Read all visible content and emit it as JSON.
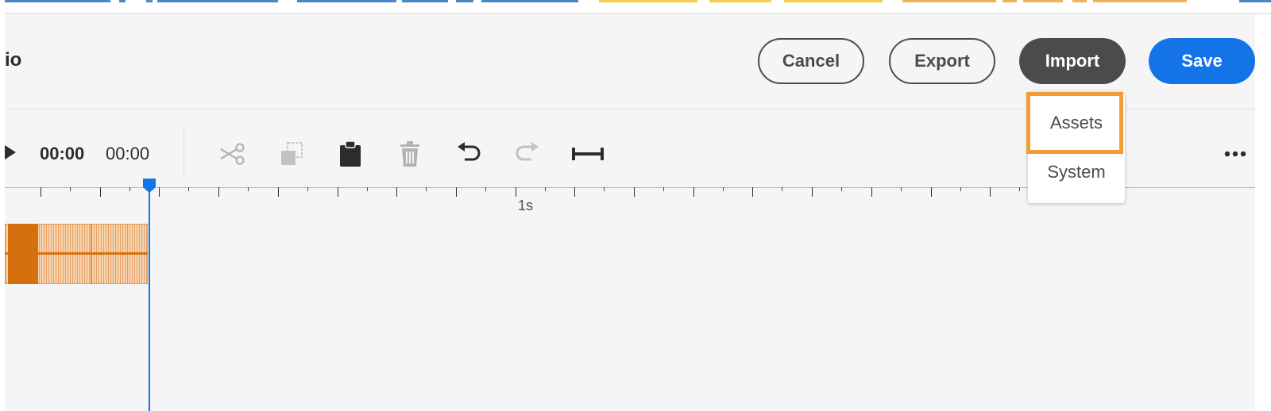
{
  "header": {
    "title_fragment": "io",
    "buttons": {
      "cancel": "Cancel",
      "export": "Export",
      "import": "Import",
      "save": "Save"
    }
  },
  "import_menu": {
    "items": [
      "Assets",
      "System"
    ],
    "highlighted_item": "Assets",
    "highlight_color": "#f39c33"
  },
  "toolbar": {
    "current_time": "00:00",
    "duration": "00:00",
    "tools": [
      {
        "name": "scissors-icon",
        "enabled": false
      },
      {
        "name": "copy-icon",
        "enabled": false
      },
      {
        "name": "paste-icon",
        "enabled": true
      },
      {
        "name": "trash-icon",
        "enabled": false
      },
      {
        "name": "undo-icon",
        "enabled": true
      },
      {
        "name": "redo-icon",
        "enabled": false
      },
      {
        "name": "fit-width-icon",
        "enabled": true
      }
    ]
  },
  "timeline": {
    "tick_label": "1s"
  },
  "colors": {
    "accent_blue": "#1473e6",
    "dark_button": "#4b4b4b",
    "clip_orange": "#d4700f",
    "clip_light": "#f5c79a"
  }
}
